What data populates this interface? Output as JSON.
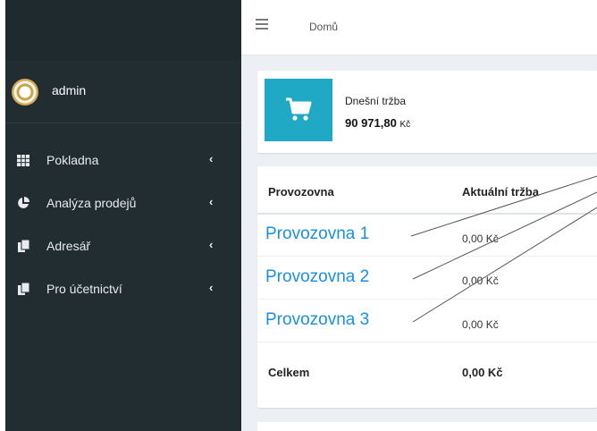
{
  "sidebar": {
    "user": {
      "name": "admin"
    },
    "items": [
      {
        "label": "Pokladna",
        "icon": "table-grid-icon"
      },
      {
        "label": "Analýza prodejů",
        "icon": "pie-chart-icon"
      },
      {
        "label": "Adresář",
        "icon": "copy-documents-icon"
      },
      {
        "label": "Pro účetnictví",
        "icon": "copy-documents-icon"
      }
    ],
    "chevron": "‹"
  },
  "header": {
    "breadcrumb": "Domů"
  },
  "info_box": {
    "title": "Dnešní tržba",
    "value": "90 971,80",
    "currency": "Kč",
    "icon": "shopping-cart-icon",
    "icon_color": "#1fa9c4"
  },
  "table": {
    "columns": [
      "Provozovna",
      "Aktuální tržba"
    ],
    "rows": [
      {
        "place": "Provozovna 1",
        "revenue": "0,00 Kč"
      },
      {
        "place": "Provozovna 2",
        "revenue": "0,00 Kč"
      },
      {
        "place": "Provozovna 3",
        "revenue": "0,00 Kč"
      }
    ],
    "total_label": "Celkem",
    "total_value": "0,00 Kč"
  },
  "colors": {
    "sidebar_bg": "#222d32",
    "accent": "#1fa9c4",
    "callout": "#1a8fe0"
  }
}
